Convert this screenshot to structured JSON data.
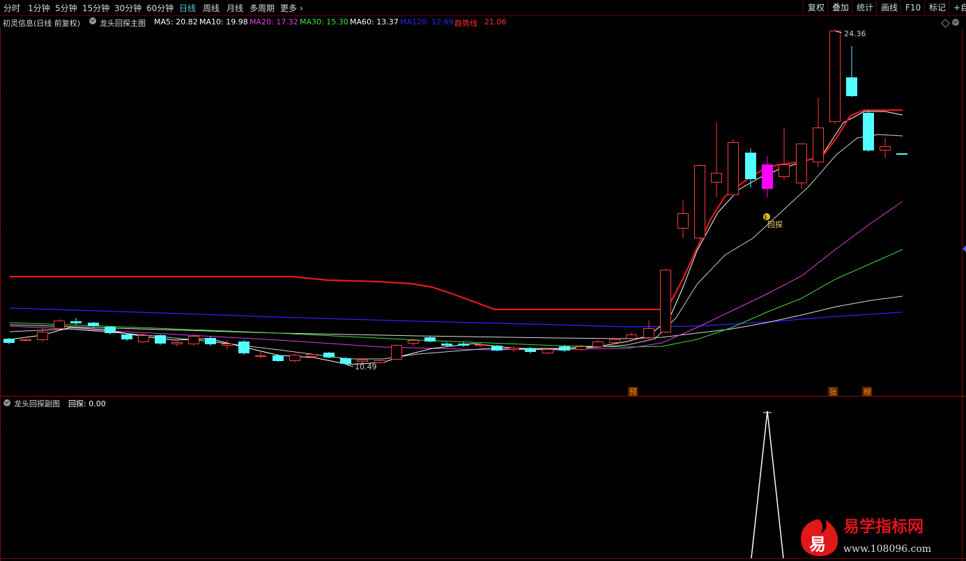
{
  "toolbar": {
    "periods": [
      {
        "label": "分时",
        "active": false
      },
      {
        "label": "1分钟",
        "active": false
      },
      {
        "label": "5分钟",
        "active": false
      },
      {
        "label": "15分钟",
        "active": false
      },
      {
        "label": "30分钟",
        "active": false
      },
      {
        "label": "60分钟",
        "active": false
      },
      {
        "label": "日线",
        "active": true
      },
      {
        "label": "周线",
        "active": false
      },
      {
        "label": "月线",
        "active": false
      },
      {
        "label": "多周期",
        "active": false
      },
      {
        "label": "更多",
        "active": false
      }
    ],
    "right_buttons": [
      "复权",
      "叠加",
      "统计",
      "画线",
      "F10",
      "标记",
      "+自"
    ]
  },
  "main_chart": {
    "stock": "初灵信息(日线 前复权)",
    "indicator_name": "龙头回探主图",
    "legend": [
      {
        "label": "MA5: 20.82",
        "color": "#ffffff"
      },
      {
        "label": "MA10: 19.98",
        "color": "#ffffff"
      },
      {
        "label": "MA20: 17.32",
        "color": "#e040e0"
      },
      {
        "label": "MA30: 15.30",
        "color": "#40e040"
      },
      {
        "label": "MA60: 13.37",
        "color": "#ffffff"
      },
      {
        "label": "MA120: 12.69",
        "color": "#2626ff"
      },
      {
        "label": "趋势线",
        "color": "#ff3030"
      },
      {
        "label": "21.06",
        "color": "#ff3030"
      }
    ],
    "high_label": "24.36",
    "low_label": "10.49",
    "signal_label": "回探",
    "markers": [
      {
        "text": "预",
        "color": "#ff6600"
      },
      {
        "text": "张",
        "color": "#ff6600"
      },
      {
        "text": "榜",
        "color": "#ff6600"
      }
    ]
  },
  "sub_chart": {
    "indicator_name": "龙头回探副图",
    "value_label": "回探: 0.00"
  },
  "watermark": {
    "logo_char": "易",
    "title": "易学指标网",
    "url": "www.108096.com"
  },
  "colors": {
    "up": "#ff3c3c",
    "down": "#54ffff",
    "special": "#ff00ff",
    "trend": "#e51a1a",
    "ma5": "#ffffff",
    "ma20": "#e040e0",
    "ma30": "#40e040",
    "ma120": "#2626ff",
    "grid": "#5a0000"
  }
}
